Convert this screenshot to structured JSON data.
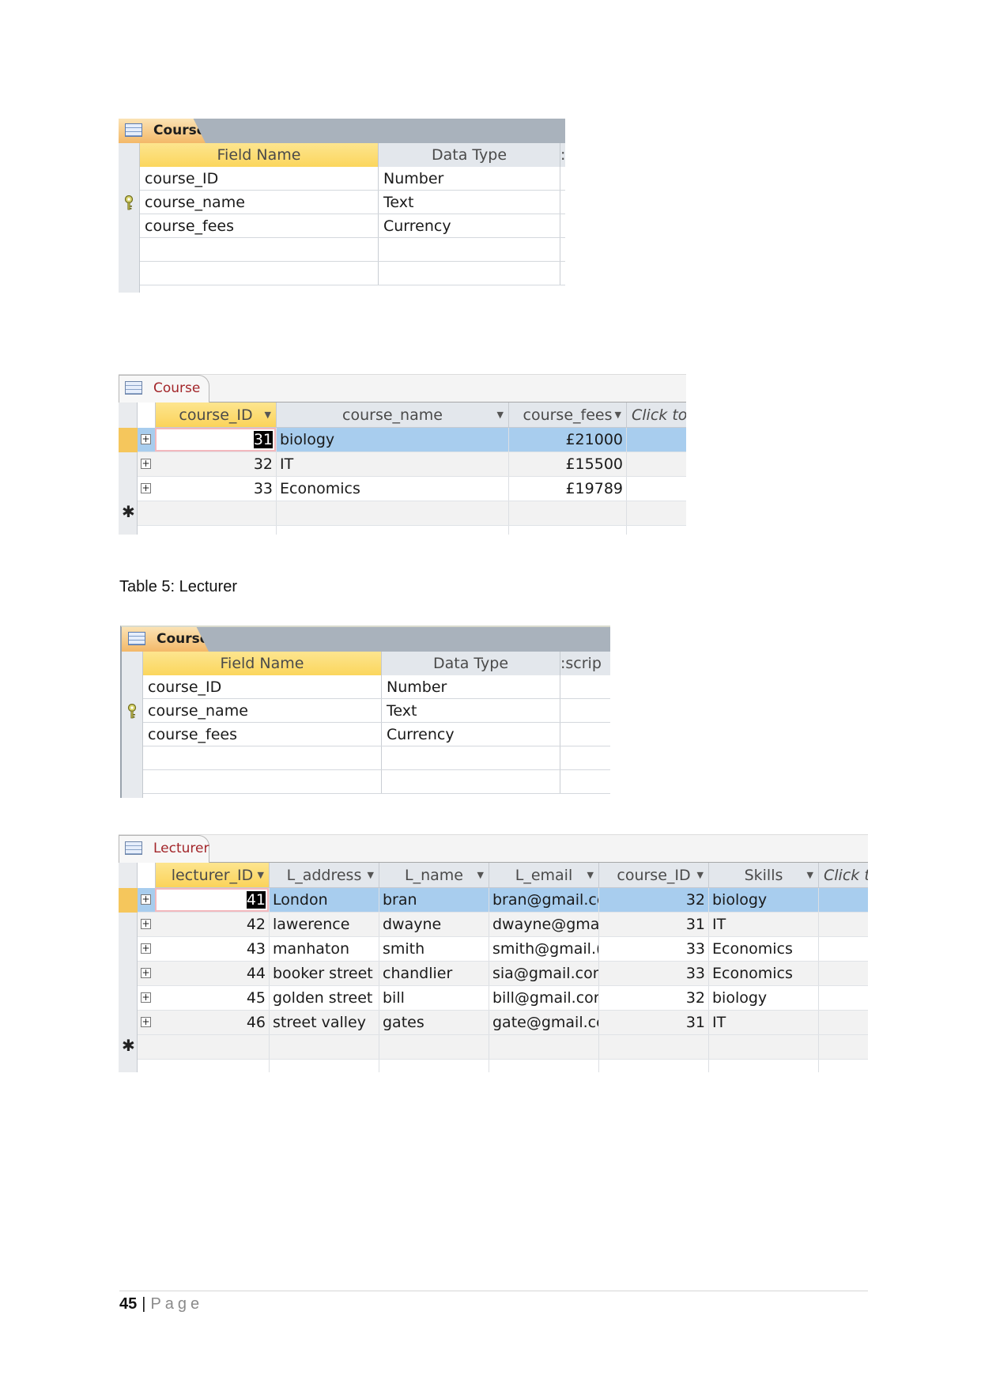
{
  "design_view_1": {
    "tab_label": "Course",
    "headers": {
      "field_name": "Field Name",
      "data_type": "Data Type",
      "description": ":"
    },
    "rows": [
      {
        "field": "course_ID",
        "type": "Number",
        "primary_key": true
      },
      {
        "field": "course_name",
        "type": "Text",
        "primary_key": false
      },
      {
        "field": "course_fees",
        "type": "Currency",
        "primary_key": false
      }
    ]
  },
  "datasheet_course": {
    "tab_label": "Course",
    "columns": [
      "course_ID",
      "course_name",
      "course_fees",
      "Click to"
    ],
    "rows": [
      {
        "course_ID": "31",
        "course_name": "biology",
        "course_fees": "£21000"
      },
      {
        "course_ID": "32",
        "course_name": "IT",
        "course_fees": "£15500"
      },
      {
        "course_ID": "33",
        "course_name": "Economics",
        "course_fees": "£19789"
      }
    ],
    "selected_row": 0
  },
  "caption": "Table 5: Lecturer",
  "design_view_2": {
    "tab_label": "Course",
    "headers": {
      "field_name": "Field Name",
      "data_type": "Data Type",
      "description": ":scrip"
    },
    "rows": [
      {
        "field": "course_ID",
        "type": "Number",
        "primary_key": true
      },
      {
        "field": "course_name",
        "type": "Text",
        "primary_key": false
      },
      {
        "field": "course_fees",
        "type": "Currency",
        "primary_key": false
      }
    ]
  },
  "datasheet_lecturer": {
    "tab_label": "Lecturer",
    "columns": [
      "lecturer_ID",
      "L_address",
      "L_name",
      "L_email",
      "course_ID",
      "Skills",
      "Click to"
    ],
    "rows": [
      {
        "lecturer_ID": "41",
        "L_address": "London",
        "L_name": "bran",
        "L_email": "bran@gmail.cc",
        "course_ID": "32",
        "Skills": "biology"
      },
      {
        "lecturer_ID": "42",
        "L_address": "lawerence",
        "L_name": "dwayne",
        "L_email": "dwayne@gma",
        "course_ID": "31",
        "Skills": "IT"
      },
      {
        "lecturer_ID": "43",
        "L_address": "manhaton",
        "L_name": "smith",
        "L_email": "smith@gmail.(",
        "course_ID": "33",
        "Skills": "Economics"
      },
      {
        "lecturer_ID": "44",
        "L_address": "booker street",
        "L_name": "chandlier",
        "L_email": "sia@gmail.con",
        "course_ID": "33",
        "Skills": "Economics"
      },
      {
        "lecturer_ID": "45",
        "L_address": "golden street",
        "L_name": "bill",
        "L_email": "bill@gmail.cor",
        "course_ID": "32",
        "Skills": "biology"
      },
      {
        "lecturer_ID": "46",
        "L_address": "street valley",
        "L_name": "gates",
        "L_email": "gate@gmail.cc",
        "course_ID": "31",
        "Skills": "IT"
      }
    ],
    "selected_row": 0
  },
  "footer": {
    "page_number": "45",
    "separator": "|",
    "page_label": "Page"
  },
  "icons": {
    "table": "table-icon",
    "key": "primary-key-icon",
    "expand": "expand-plus-icon",
    "new_record": "asterisk-icon",
    "sort": "dropdown-arrow-icon"
  },
  "colors": {
    "header_active": "#fbd65d",
    "selected_row": "#a8cdee",
    "tab_label_red": "#a3262a",
    "tab_orange": "#f3b868"
  }
}
